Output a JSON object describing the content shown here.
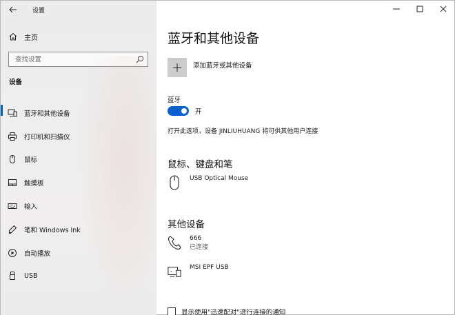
{
  "window": {
    "title": "设置",
    "minimize_icon": "minimize-icon",
    "maximize_icon": "maximize-icon",
    "close_icon": "close-icon"
  },
  "sidebar": {
    "home_label": "主页",
    "search_placeholder": "查找设置",
    "section_title": "设备",
    "items": [
      {
        "label": "蓝牙和其他设备",
        "icon": "bluetooth-devices-icon",
        "active": true
      },
      {
        "label": "打印机和扫描仪",
        "icon": "printer-icon",
        "active": false
      },
      {
        "label": "鼠标",
        "icon": "mouse-icon",
        "active": false
      },
      {
        "label": "触摸板",
        "icon": "touchpad-icon",
        "active": false
      },
      {
        "label": "输入",
        "icon": "keyboard-icon",
        "active": false
      },
      {
        "label": "笔和 Windows Ink",
        "icon": "pen-icon",
        "active": false
      },
      {
        "label": "自动播放",
        "icon": "autoplay-icon",
        "active": false
      },
      {
        "label": "USB",
        "icon": "usb-icon",
        "active": false
      }
    ]
  },
  "main": {
    "title": "蓝牙和其他设备",
    "add_device_label": "添加蓝牙或其他设备",
    "bluetooth": {
      "label": "蓝牙",
      "state_text": "开",
      "enabled": true,
      "description": "打开此选项，设备 JINLIUHUANG 将可供其他用户连接"
    },
    "mouse_section": {
      "title": "鼠标、键盘和笔",
      "devices": [
        {
          "name": "USB Optical Mouse",
          "icon": "mouse-icon"
        }
      ]
    },
    "other_section": {
      "title": "其他设备",
      "devices": [
        {
          "name": "666",
          "status": "已连接",
          "icon": "phone-icon"
        },
        {
          "name": "MSI EPF USB",
          "icon": "device-icon"
        }
      ]
    },
    "swift_pair_label": "显示使用\"迅速配对\"进行连接的通知"
  },
  "colors": {
    "accent": "#0063b1",
    "toggle_on": "#0a5fd1",
    "sidebar_bg": "#eeeeee"
  }
}
